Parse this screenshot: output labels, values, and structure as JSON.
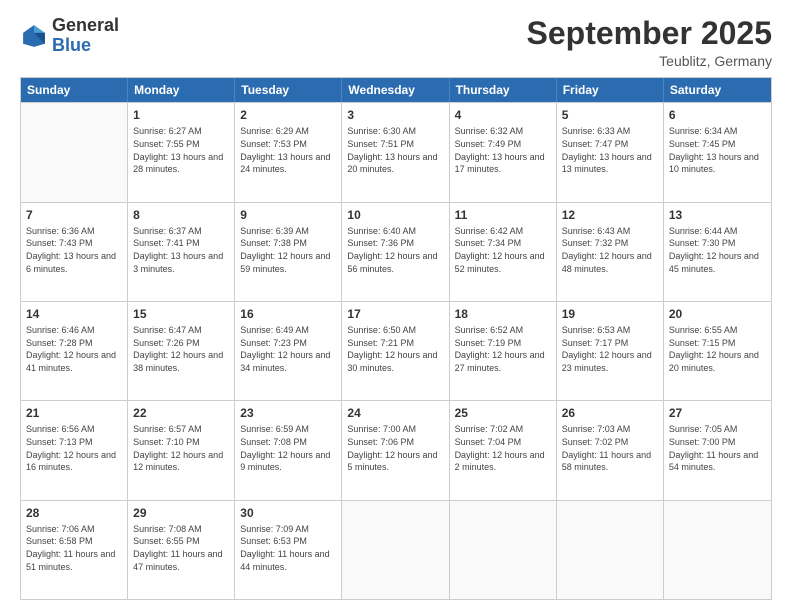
{
  "logo": {
    "general": "General",
    "blue": "Blue"
  },
  "header": {
    "month": "September 2025",
    "location": "Teublitz, Germany"
  },
  "days": [
    "Sunday",
    "Monday",
    "Tuesday",
    "Wednesday",
    "Thursday",
    "Friday",
    "Saturday"
  ],
  "weeks": [
    [
      {
        "day": "",
        "empty": true
      },
      {
        "day": "1",
        "sunrise": "Sunrise: 6:27 AM",
        "sunset": "Sunset: 7:55 PM",
        "daylight": "Daylight: 13 hours and 28 minutes."
      },
      {
        "day": "2",
        "sunrise": "Sunrise: 6:29 AM",
        "sunset": "Sunset: 7:53 PM",
        "daylight": "Daylight: 13 hours and 24 minutes."
      },
      {
        "day": "3",
        "sunrise": "Sunrise: 6:30 AM",
        "sunset": "Sunset: 7:51 PM",
        "daylight": "Daylight: 13 hours and 20 minutes."
      },
      {
        "day": "4",
        "sunrise": "Sunrise: 6:32 AM",
        "sunset": "Sunset: 7:49 PM",
        "daylight": "Daylight: 13 hours and 17 minutes."
      },
      {
        "day": "5",
        "sunrise": "Sunrise: 6:33 AM",
        "sunset": "Sunset: 7:47 PM",
        "daylight": "Daylight: 13 hours and 13 minutes."
      },
      {
        "day": "6",
        "sunrise": "Sunrise: 6:34 AM",
        "sunset": "Sunset: 7:45 PM",
        "daylight": "Daylight: 13 hours and 10 minutes."
      }
    ],
    [
      {
        "day": "7",
        "sunrise": "Sunrise: 6:36 AM",
        "sunset": "Sunset: 7:43 PM",
        "daylight": "Daylight: 13 hours and 6 minutes."
      },
      {
        "day": "8",
        "sunrise": "Sunrise: 6:37 AM",
        "sunset": "Sunset: 7:41 PM",
        "daylight": "Daylight: 13 hours and 3 minutes."
      },
      {
        "day": "9",
        "sunrise": "Sunrise: 6:39 AM",
        "sunset": "Sunset: 7:38 PM",
        "daylight": "Daylight: 12 hours and 59 minutes."
      },
      {
        "day": "10",
        "sunrise": "Sunrise: 6:40 AM",
        "sunset": "Sunset: 7:36 PM",
        "daylight": "Daylight: 12 hours and 56 minutes."
      },
      {
        "day": "11",
        "sunrise": "Sunrise: 6:42 AM",
        "sunset": "Sunset: 7:34 PM",
        "daylight": "Daylight: 12 hours and 52 minutes."
      },
      {
        "day": "12",
        "sunrise": "Sunrise: 6:43 AM",
        "sunset": "Sunset: 7:32 PM",
        "daylight": "Daylight: 12 hours and 48 minutes."
      },
      {
        "day": "13",
        "sunrise": "Sunrise: 6:44 AM",
        "sunset": "Sunset: 7:30 PM",
        "daylight": "Daylight: 12 hours and 45 minutes."
      }
    ],
    [
      {
        "day": "14",
        "sunrise": "Sunrise: 6:46 AM",
        "sunset": "Sunset: 7:28 PM",
        "daylight": "Daylight: 12 hours and 41 minutes."
      },
      {
        "day": "15",
        "sunrise": "Sunrise: 6:47 AM",
        "sunset": "Sunset: 7:26 PM",
        "daylight": "Daylight: 12 hours and 38 minutes."
      },
      {
        "day": "16",
        "sunrise": "Sunrise: 6:49 AM",
        "sunset": "Sunset: 7:23 PM",
        "daylight": "Daylight: 12 hours and 34 minutes."
      },
      {
        "day": "17",
        "sunrise": "Sunrise: 6:50 AM",
        "sunset": "Sunset: 7:21 PM",
        "daylight": "Daylight: 12 hours and 30 minutes."
      },
      {
        "day": "18",
        "sunrise": "Sunrise: 6:52 AM",
        "sunset": "Sunset: 7:19 PM",
        "daylight": "Daylight: 12 hours and 27 minutes."
      },
      {
        "day": "19",
        "sunrise": "Sunrise: 6:53 AM",
        "sunset": "Sunset: 7:17 PM",
        "daylight": "Daylight: 12 hours and 23 minutes."
      },
      {
        "day": "20",
        "sunrise": "Sunrise: 6:55 AM",
        "sunset": "Sunset: 7:15 PM",
        "daylight": "Daylight: 12 hours and 20 minutes."
      }
    ],
    [
      {
        "day": "21",
        "sunrise": "Sunrise: 6:56 AM",
        "sunset": "Sunset: 7:13 PM",
        "daylight": "Daylight: 12 hours and 16 minutes."
      },
      {
        "day": "22",
        "sunrise": "Sunrise: 6:57 AM",
        "sunset": "Sunset: 7:10 PM",
        "daylight": "Daylight: 12 hours and 12 minutes."
      },
      {
        "day": "23",
        "sunrise": "Sunrise: 6:59 AM",
        "sunset": "Sunset: 7:08 PM",
        "daylight": "Daylight: 12 hours and 9 minutes."
      },
      {
        "day": "24",
        "sunrise": "Sunrise: 7:00 AM",
        "sunset": "Sunset: 7:06 PM",
        "daylight": "Daylight: 12 hours and 5 minutes."
      },
      {
        "day": "25",
        "sunrise": "Sunrise: 7:02 AM",
        "sunset": "Sunset: 7:04 PM",
        "daylight": "Daylight: 12 hours and 2 minutes."
      },
      {
        "day": "26",
        "sunrise": "Sunrise: 7:03 AM",
        "sunset": "Sunset: 7:02 PM",
        "daylight": "Daylight: 11 hours and 58 minutes."
      },
      {
        "day": "27",
        "sunrise": "Sunrise: 7:05 AM",
        "sunset": "Sunset: 7:00 PM",
        "daylight": "Daylight: 11 hours and 54 minutes."
      }
    ],
    [
      {
        "day": "28",
        "sunrise": "Sunrise: 7:06 AM",
        "sunset": "Sunset: 6:58 PM",
        "daylight": "Daylight: 11 hours and 51 minutes."
      },
      {
        "day": "29",
        "sunrise": "Sunrise: 7:08 AM",
        "sunset": "Sunset: 6:55 PM",
        "daylight": "Daylight: 11 hours and 47 minutes."
      },
      {
        "day": "30",
        "sunrise": "Sunrise: 7:09 AM",
        "sunset": "Sunset: 6:53 PM",
        "daylight": "Daylight: 11 hours and 44 minutes."
      },
      {
        "day": "",
        "empty": true
      },
      {
        "day": "",
        "empty": true
      },
      {
        "day": "",
        "empty": true
      },
      {
        "day": "",
        "empty": true
      }
    ]
  ]
}
